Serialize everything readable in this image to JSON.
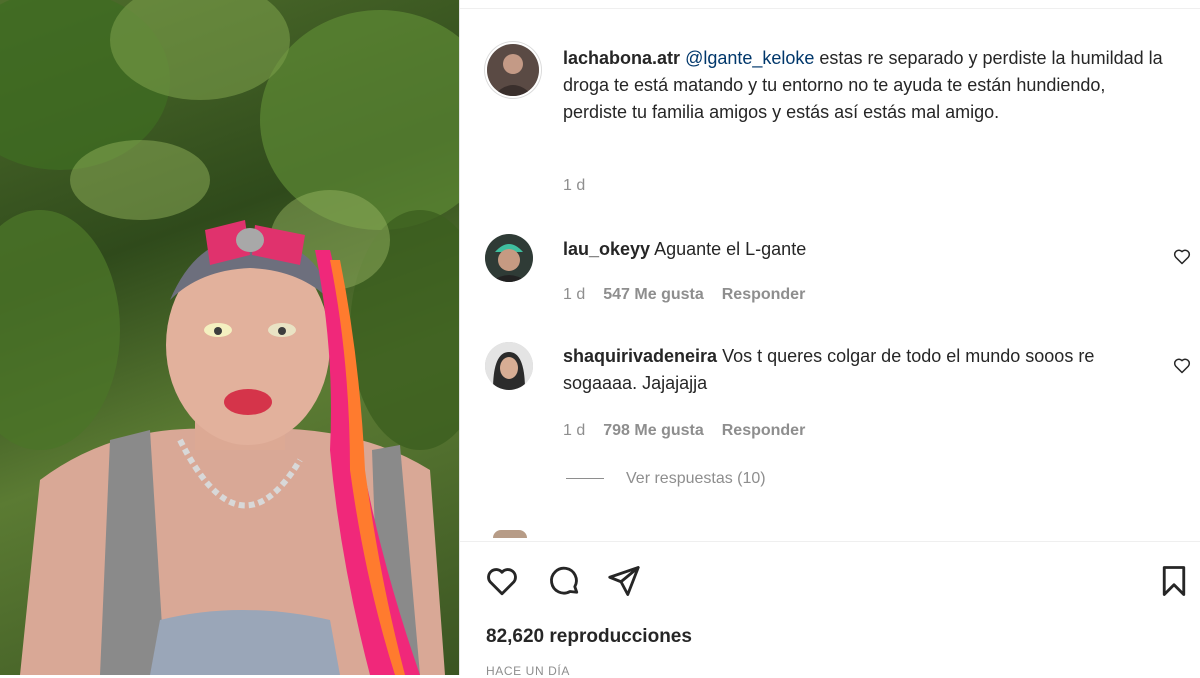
{
  "post": {
    "author": "lachabona.atr",
    "mention": "@lgante_keloke",
    "caption_text": " estas re separado y perdiste la humildad la droga te está matando y tu entorno no te ayuda te están hundiendo, perdiste tu familia amigos y estás así estás mal amigo.",
    "age": "1 d"
  },
  "comments": [
    {
      "username": "lau_okeyy",
      "text": "Aguante el L-gante",
      "age": "1 d",
      "likes": "547 Me gusta",
      "reply_label": "Responder"
    },
    {
      "username": "shaquirivadeneira",
      "text": "Vos t queres colgar de todo el mundo sooos re sogaaaa. Jajajajja",
      "age": "1 d",
      "likes": "798 Me gusta",
      "reply_label": "Responder"
    }
  ],
  "view_replies": "Ver respuestas (10)",
  "stats": {
    "views": "82,620 reproducciones",
    "posted": "HACE UN DÍA"
  },
  "icons": [
    "heart-icon",
    "comment-icon",
    "share-icon",
    "bookmark-icon"
  ],
  "colors": {
    "mention": "#00376b",
    "secondary_text": "#8e8e8e"
  }
}
